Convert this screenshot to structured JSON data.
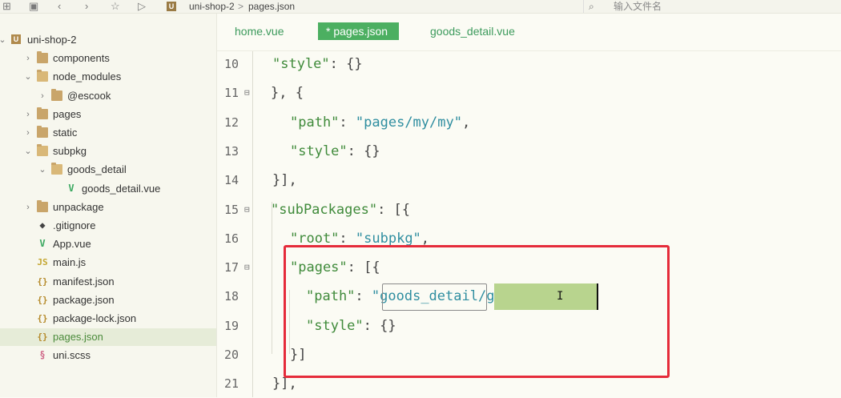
{
  "toolbar": {
    "breadcrumb_project": "uni-shop-2",
    "breadcrumb_sep": ">",
    "breadcrumb_file": "pages.json",
    "search_placeholder": "输入文件名",
    "logo_letter": "U"
  },
  "sidebar": {
    "items": [
      {
        "label": "uni-shop-2",
        "type": "project",
        "arrow": "⌄",
        "icon": "project-icon"
      },
      {
        "label": "components",
        "type": "folder",
        "arrow": "›",
        "icon": "folder-icon"
      },
      {
        "label": "node_modules",
        "type": "folder-open",
        "arrow": "⌄",
        "icon": "folder-open-icon"
      },
      {
        "label": "@escook",
        "type": "folder",
        "arrow": "›",
        "icon": "folder-icon"
      },
      {
        "label": "pages",
        "type": "folder",
        "arrow": "›",
        "icon": "folder-icon"
      },
      {
        "label": "static",
        "type": "folder",
        "arrow": "›",
        "icon": "folder-icon"
      },
      {
        "label": "subpkg",
        "type": "folder-open",
        "arrow": "⌄",
        "icon": "folder-open-icon"
      },
      {
        "label": "goods_detail",
        "type": "folder-open",
        "arrow": "⌄",
        "icon": "folder-open-icon"
      },
      {
        "label": "goods_detail.vue",
        "type": "vue",
        "arrow": "",
        "icon": "vue-file-icon",
        "glyph": "V"
      },
      {
        "label": "unpackage",
        "type": "folder",
        "arrow": "›",
        "icon": "folder-icon"
      },
      {
        "label": ".gitignore",
        "type": "git",
        "arrow": "",
        "icon": "git-file-icon",
        "glyph": "◆"
      },
      {
        "label": "App.vue",
        "type": "vue",
        "arrow": "",
        "icon": "vue-file-icon",
        "glyph": "V"
      },
      {
        "label": "main.js",
        "type": "js",
        "arrow": "",
        "icon": "js-file-icon",
        "glyph": "JS"
      },
      {
        "label": "manifest.json",
        "type": "json",
        "arrow": "",
        "icon": "json-file-icon",
        "glyph": "{}"
      },
      {
        "label": "package.json",
        "type": "json",
        "arrow": "",
        "icon": "json-file-icon",
        "glyph": "{}"
      },
      {
        "label": "package-lock.json",
        "type": "json",
        "arrow": "",
        "icon": "json-file-icon",
        "glyph": "{}"
      },
      {
        "label": "pages.json",
        "type": "json",
        "arrow": "",
        "icon": "json-file-icon",
        "glyph": "{}",
        "selected": true
      },
      {
        "label": "uni.scss",
        "type": "scss",
        "arrow": "",
        "icon": "scss-file-icon",
        "glyph": "§"
      }
    ]
  },
  "tabs": [
    {
      "label": "home.vue",
      "active": false
    },
    {
      "label": "* pages.json",
      "active": true
    },
    {
      "label": "goods_detail.vue",
      "active": false
    }
  ],
  "code_lines": [
    {
      "num": "10",
      "fold": "",
      "tokens": [
        [
          "k",
          "\"style\""
        ],
        [
          "p",
          ": {}"
        ]
      ]
    },
    {
      "num": "11",
      "fold": "⊟",
      "tokens": [
        [
          "p",
          "}, {"
        ]
      ]
    },
    {
      "num": "12",
      "fold": "",
      "tokens": [
        [
          "k",
          "\"path\""
        ],
        [
          "p",
          ": "
        ],
        [
          "s",
          "\"pages/my/my\""
        ],
        [
          "p",
          ","
        ]
      ]
    },
    {
      "num": "13",
      "fold": "",
      "tokens": [
        [
          "k",
          "\"style\""
        ],
        [
          "p",
          ": {}"
        ]
      ]
    },
    {
      "num": "14",
      "fold": "",
      "tokens": [
        [
          "p",
          "}],"
        ]
      ]
    },
    {
      "num": "15",
      "fold": "⊟",
      "tokens": [
        [
          "k",
          "\"subPackages\""
        ],
        [
          "p",
          ": [{"
        ]
      ]
    },
    {
      "num": "16",
      "fold": "",
      "tokens": [
        [
          "k",
          "\"root\""
        ],
        [
          "p",
          ": "
        ],
        [
          "s",
          "\"subpkg\""
        ],
        [
          "p",
          ","
        ]
      ]
    },
    {
      "num": "17",
      "fold": "⊟",
      "tokens": [
        [
          "k",
          "\"pages\""
        ],
        [
          "p",
          ": [{"
        ]
      ]
    },
    {
      "num": "18",
      "fold": "",
      "tokens": [
        [
          "k",
          "\"path\""
        ],
        [
          "p",
          ": "
        ],
        [
          "s",
          "\"goods_detail/goods_detail\""
        ],
        [
          "p",
          ","
        ]
      ]
    },
    {
      "num": "19",
      "fold": "",
      "tokens": [
        [
          "k",
          "\"style\""
        ],
        [
          "p",
          ": {}"
        ]
      ]
    },
    {
      "num": "20",
      "fold": "",
      "tokens": [
        [
          "p",
          "}]"
        ]
      ]
    },
    {
      "num": "21",
      "fold": "",
      "tokens": [
        [
          "p",
          "}],"
        ]
      ]
    }
  ]
}
